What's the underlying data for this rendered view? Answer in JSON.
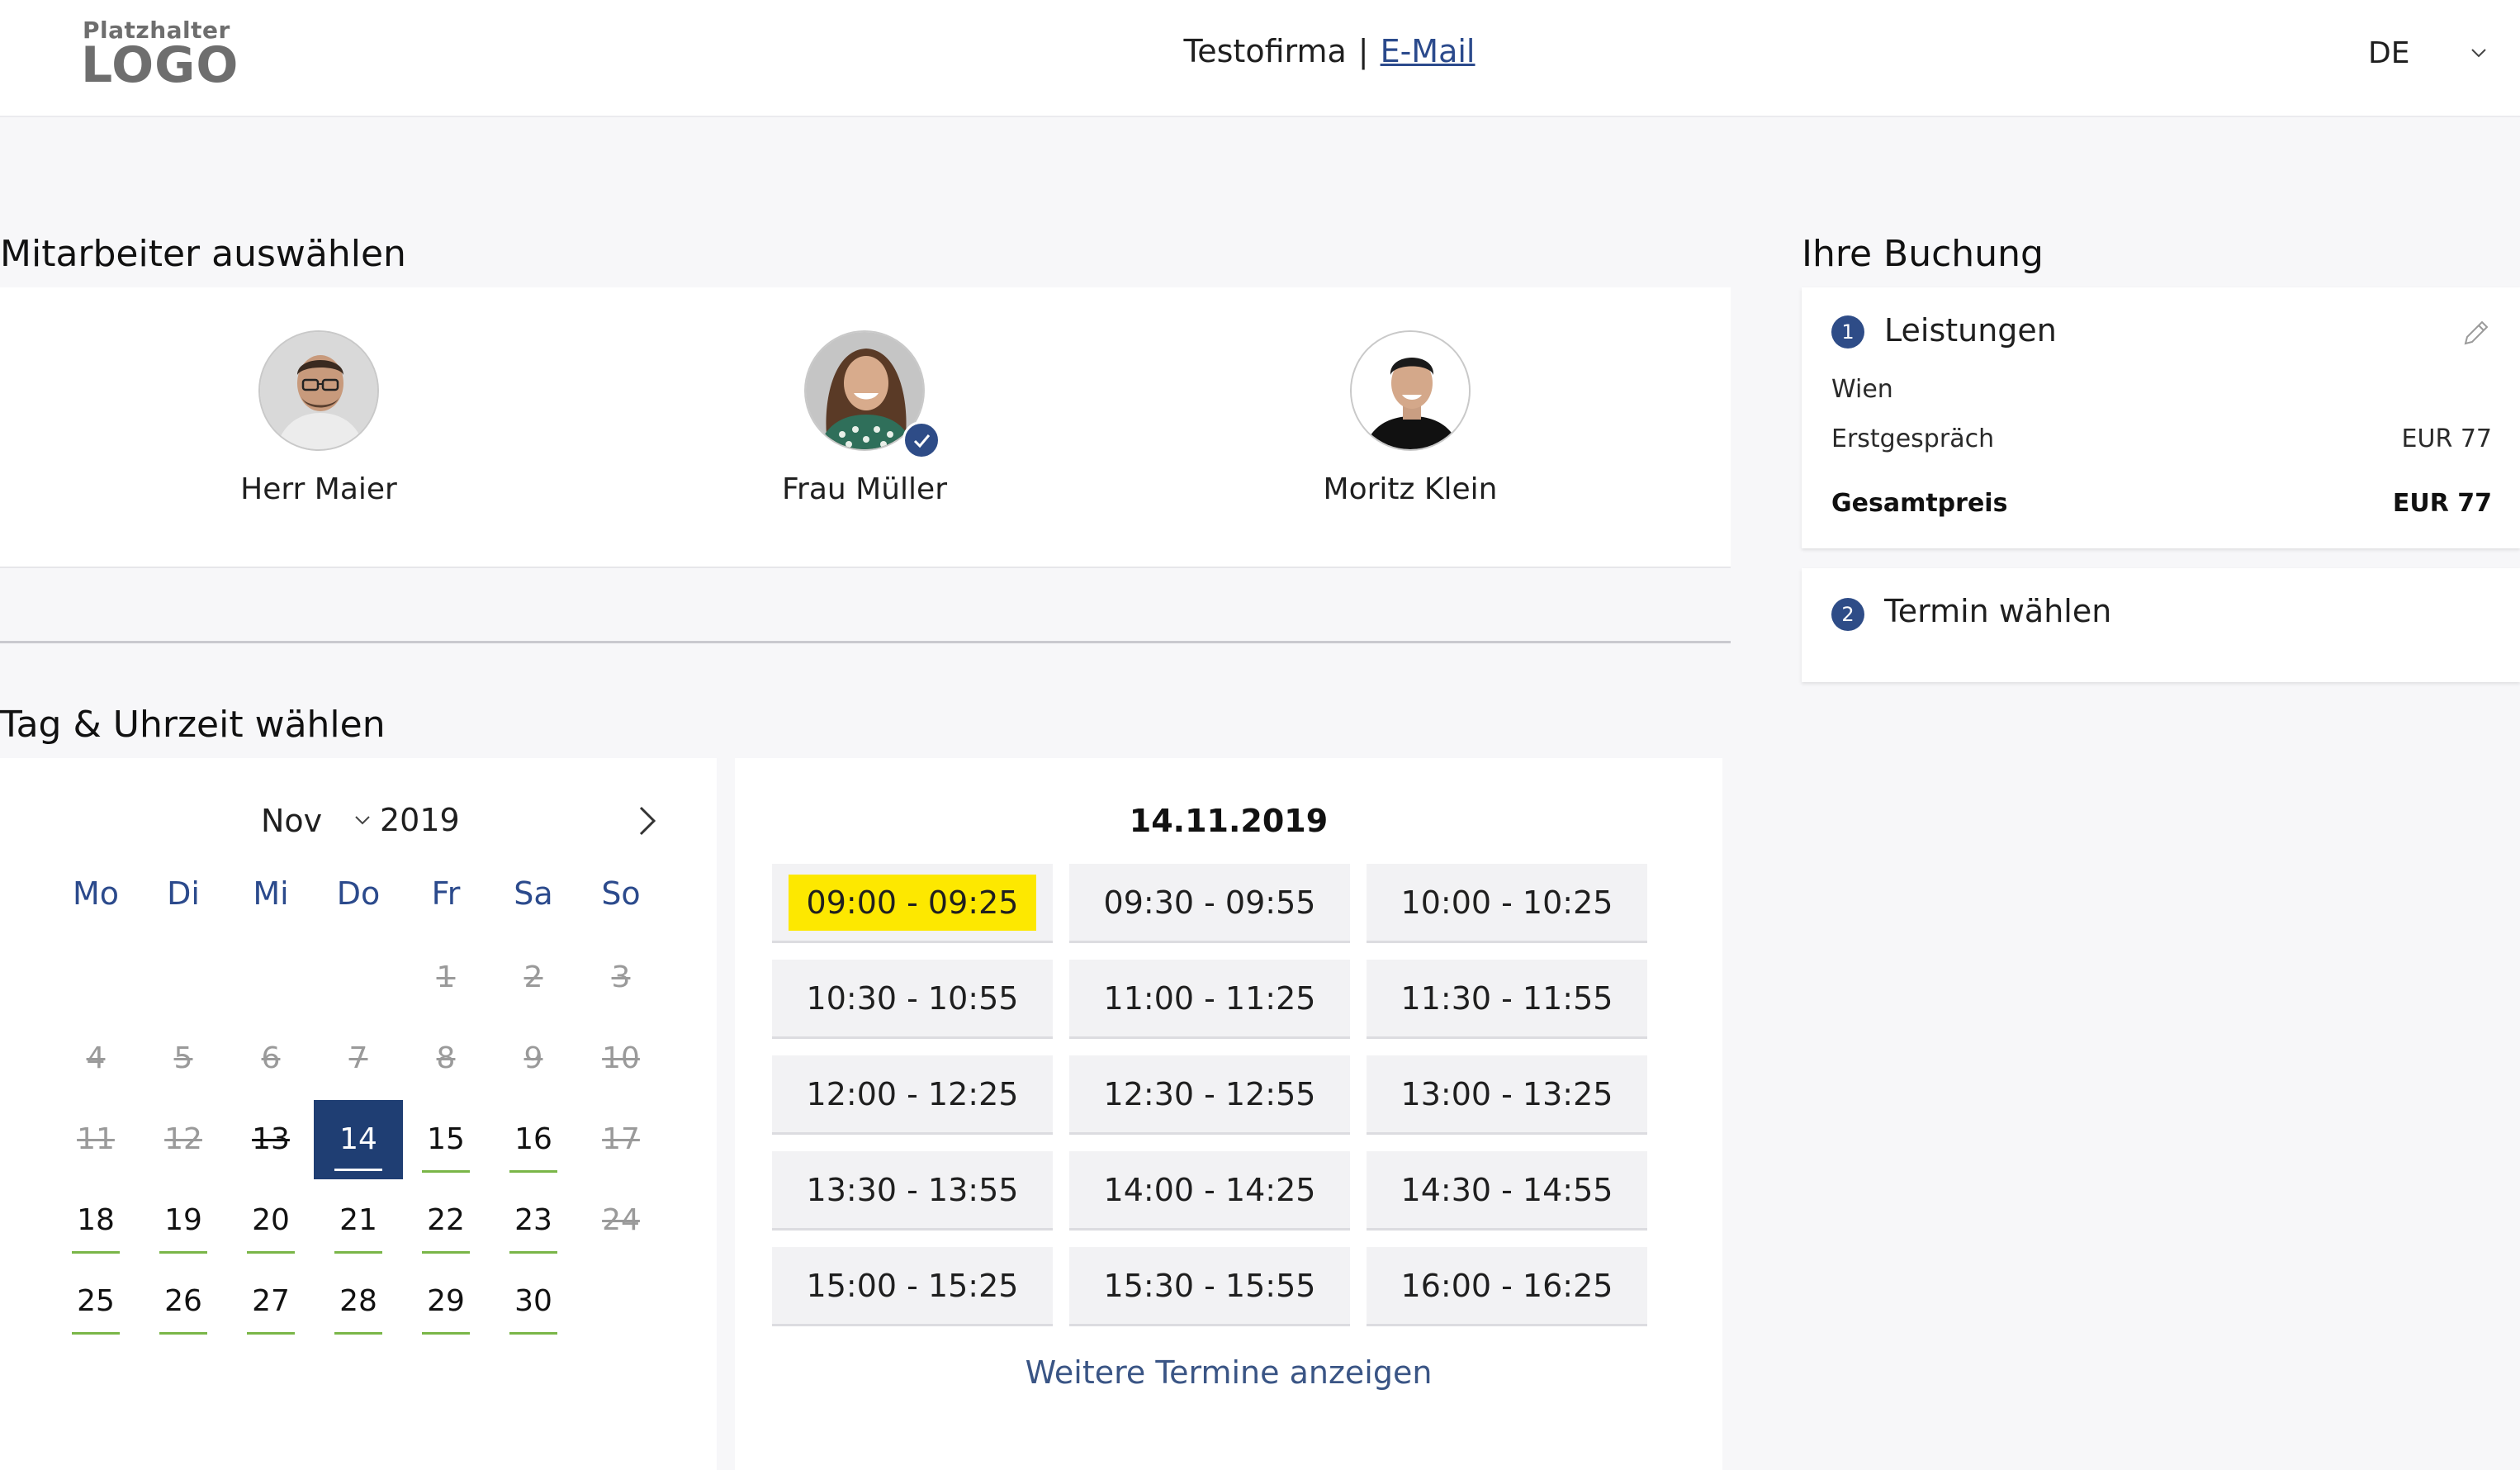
{
  "header": {
    "logo_small": "Platzhalter",
    "logo_big": "LOGO",
    "company": "Testofirma",
    "separator": "|",
    "email_link": "E-Mail",
    "language": "DE"
  },
  "employees": {
    "title": "Mitarbeiter auswählen",
    "items": [
      {
        "name": "Herr Maier"
      },
      {
        "name": "Frau Müller",
        "selected": true
      },
      {
        "name": "Moritz Klein"
      }
    ]
  },
  "calendar": {
    "title": "Tag & Uhrzeit wählen",
    "month": "Nov",
    "year": "2019",
    "weekdays": [
      "Mo",
      "Di",
      "Mi",
      "Do",
      "Fr",
      "Sa",
      "So"
    ],
    "days": [
      "1",
      "2",
      "3",
      "4",
      "5",
      "6",
      "7",
      "8",
      "9",
      "10",
      "11",
      "12",
      "13",
      "14",
      "15",
      "16",
      "17",
      "18",
      "19",
      "20",
      "21",
      "22",
      "23",
      "24",
      "25",
      "26",
      "27",
      "28",
      "29",
      "30"
    ],
    "selected_day": "14"
  },
  "timeslots": {
    "date": "14.11.2019",
    "slots": [
      "09:00 - 09:25",
      "09:30 - 09:55",
      "10:00 - 10:25",
      "10:30 - 10:55",
      "11:00 - 11:25",
      "11:30 - 11:55",
      "12:00 - 12:25",
      "12:30 - 12:55",
      "13:00 - 13:25",
      "13:30 - 13:55",
      "14:00 - 14:25",
      "14:30 - 14:55",
      "15:00 - 15:25",
      "15:30 - 15:55",
      "16:00 - 16:25"
    ],
    "more_link": "Weitere Termine anzeigen"
  },
  "booking": {
    "title": "Ihre Buchung",
    "step1": {
      "number": "1",
      "title": "Leistungen",
      "location": "Wien",
      "service": "Erstgespräch",
      "service_price": "EUR 77",
      "total_label": "Gesamtpreis",
      "total_price": "EUR 77"
    },
    "step2": {
      "number": "2",
      "title": "Termin wählen"
    }
  },
  "colors": {
    "primary": "#2e4c87",
    "selected_day": "#1f3e73",
    "highlight": "#fde800",
    "available_underline": "#7ab648"
  }
}
